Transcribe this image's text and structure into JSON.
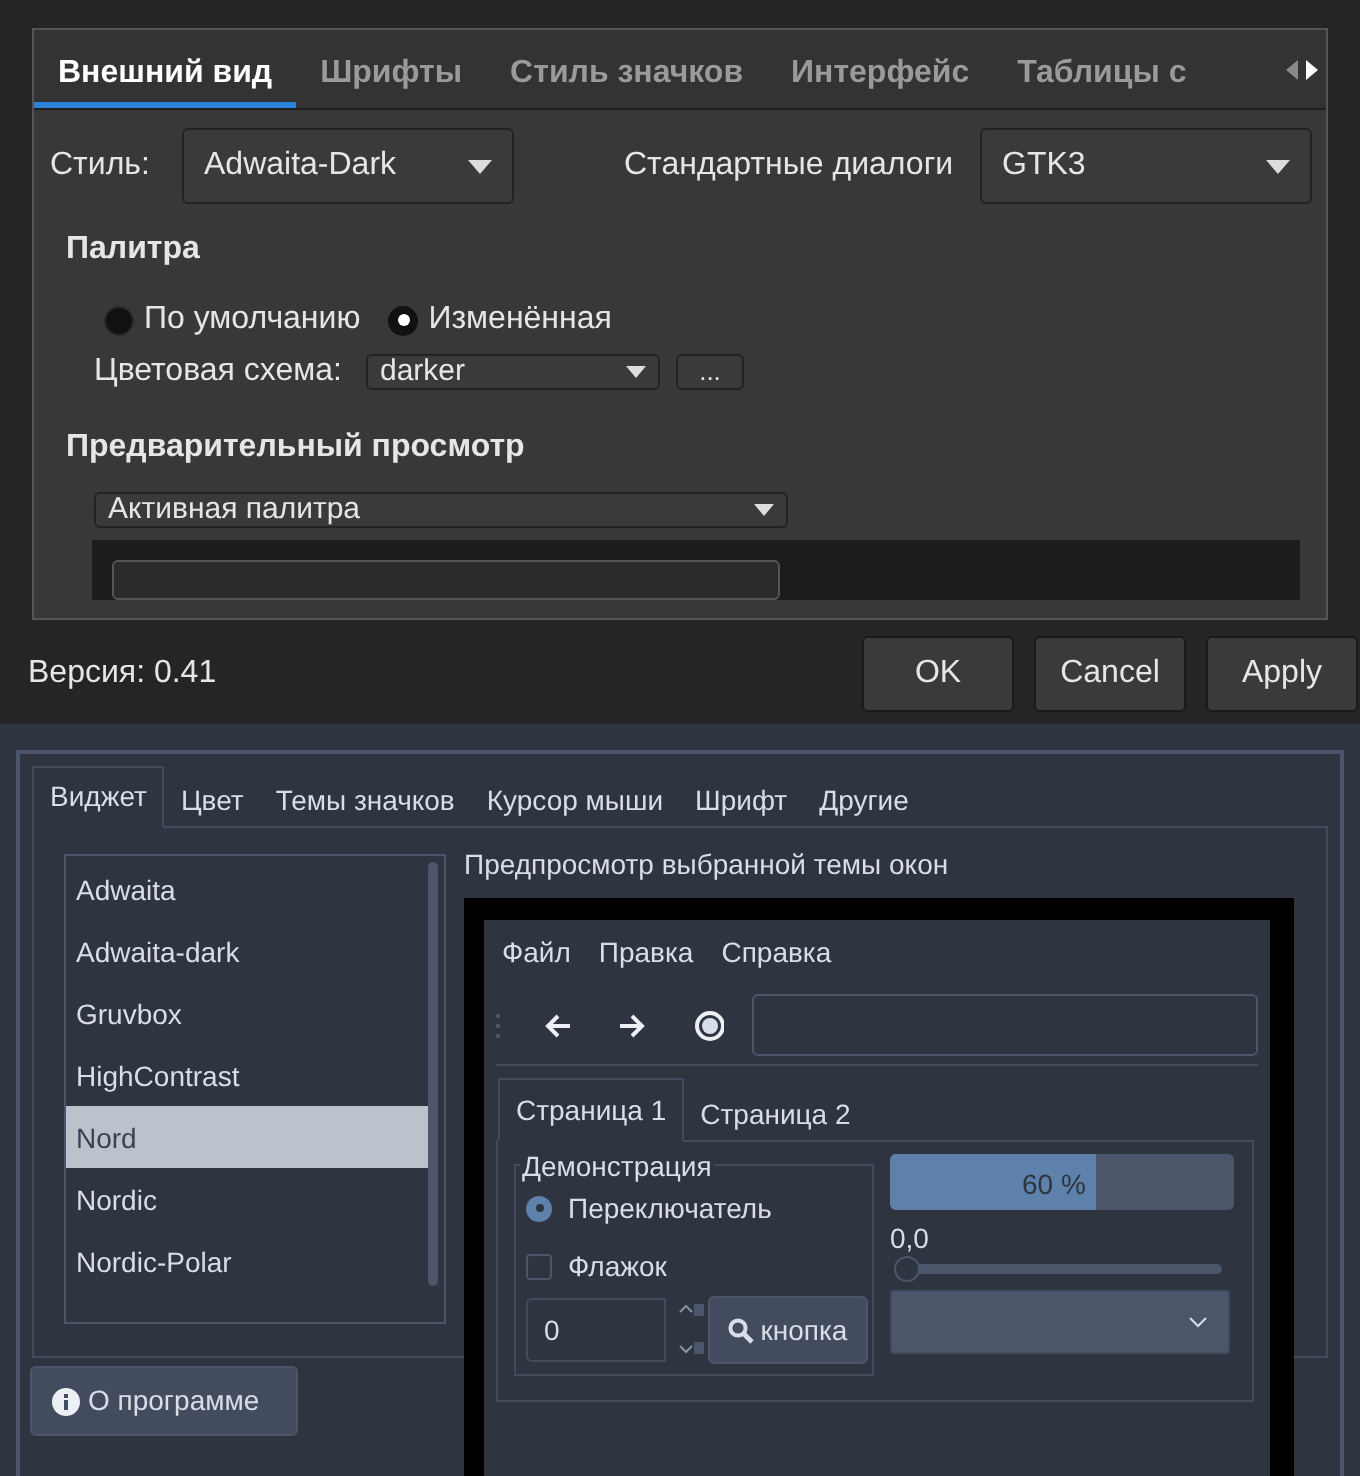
{
  "settings_window": {
    "tabs": [
      {
        "label": "Внешний вид",
        "selected": true
      },
      {
        "label": "Шрифты",
        "selected": false
      },
      {
        "label": "Стиль значков",
        "selected": false
      },
      {
        "label": "Интерфейс",
        "selected": false
      },
      {
        "label": "Таблицы с",
        "selected": false
      }
    ],
    "style": {
      "label": "Стиль:",
      "value": "Adwaita-Dark"
    },
    "dialogs": {
      "label": "Стандартные диалоги",
      "value": "GTK3"
    },
    "palette": {
      "heading": "Палитра",
      "options": [
        {
          "label": "По умолчанию",
          "selected": false
        },
        {
          "label": "Изменённая",
          "selected": true
        }
      ],
      "scheme_label": "Цветовая схема:",
      "scheme_value": "darker",
      "more_button": "..."
    },
    "preview": {
      "heading": "Предварительный просмотр",
      "palette_select": "Активная палитра"
    },
    "version": "Версия: 0.41",
    "buttons": [
      "OK",
      "Cancel",
      "Apply"
    ]
  },
  "theme_window": {
    "tabs": [
      {
        "label": "Виджет",
        "selected": true
      },
      {
        "label": "Цвет",
        "selected": false
      },
      {
        "label": "Темы значков",
        "selected": false
      },
      {
        "label": "Курсор мыши",
        "selected": false
      },
      {
        "label": "Шрифт",
        "selected": false
      },
      {
        "label": "Другие",
        "selected": false
      }
    ],
    "themes": [
      {
        "name": "Adwaita",
        "selected": false
      },
      {
        "name": "Adwaita-dark",
        "selected": false
      },
      {
        "name": "Gruvbox",
        "selected": false
      },
      {
        "name": "HighContrast",
        "selected": false
      },
      {
        "name": "Nord",
        "selected": true
      },
      {
        "name": "Nordic",
        "selected": false
      },
      {
        "name": "Nordic-Polar",
        "selected": false
      }
    ],
    "preview_label": "Предпросмотр выбранной темы окон",
    "preview": {
      "menu": [
        "Файл",
        "Правка",
        "Справка"
      ],
      "tabs": [
        {
          "label": "Страница 1",
          "selected": true
        },
        {
          "label": "Страница 2",
          "selected": false
        }
      ],
      "group_title": "Демонстрация",
      "radio": {
        "label": "Переключатель",
        "checked": true
      },
      "checkbox": {
        "label": "Флажок",
        "checked": false
      },
      "spin_value": "0",
      "button": "кнопка",
      "progress": {
        "level": 0.6,
        "text": "60 %"
      },
      "slider": {
        "reading": "0,0",
        "level": 0
      }
    },
    "about_button": "О программе"
  }
}
